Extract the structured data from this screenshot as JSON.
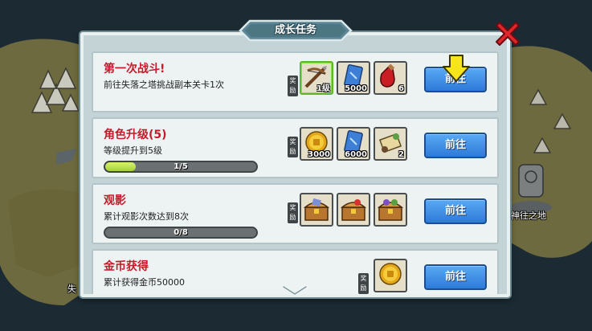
{
  "dialog": {
    "title": "成长任务",
    "reward_tag": "奖励",
    "go_label": "前往"
  },
  "map": {
    "labels": [
      "神往之地",
      "失"
    ]
  },
  "tasks": [
    {
      "title": "第一次战斗!",
      "desc": "前往失落之塔挑战副本关卡1次",
      "rewards": [
        {
          "icon": "crossbow-icon",
          "count": "1级"
        },
        {
          "icon": "blue-card-icon",
          "count": "5000"
        },
        {
          "icon": "red-potion-icon",
          "count": "6"
        }
      ]
    },
    {
      "title": "角色升级(5)",
      "desc": "等级提升到5级",
      "progress": {
        "text": "1/5",
        "value": 0.2
      },
      "rewards": [
        {
          "icon": "gold-coin-icon",
          "count": "3000"
        },
        {
          "icon": "blue-card-icon",
          "count": "6000"
        },
        {
          "icon": "scroll-icon",
          "count": "2"
        }
      ]
    },
    {
      "title": "观影",
      "desc": "累计观影次数达到8次",
      "progress": {
        "text": "0/8",
        "value": 0
      },
      "rewards": [
        {
          "icon": "treasure-chest-icon",
          "count": ""
        },
        {
          "icon": "treasure-chest-icon",
          "count": ""
        },
        {
          "icon": "treasure-chest-icon",
          "count": ""
        }
      ]
    },
    {
      "title": "金币获得",
      "desc": "累计获得金币50000",
      "rewards": [
        {
          "icon": "gold-coin-icon",
          "count": ""
        }
      ]
    }
  ],
  "colors": {
    "task_title": "#c41b2b",
    "button": "#2d7ad8",
    "panel": "#c4d3d6"
  }
}
